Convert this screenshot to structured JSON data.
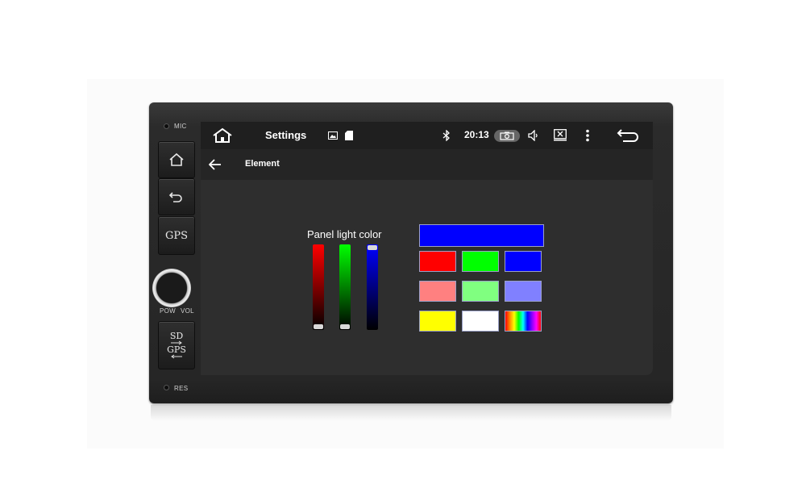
{
  "device": {
    "mic_label": "MIC",
    "gps_button_label": "GPS",
    "pow_label": "POW",
    "vol_label": "VOL",
    "sd_label": "SD",
    "sd_gps_label": "GPS",
    "res_label": "RES"
  },
  "statusbar": {
    "title": "Settings",
    "time": "20:13",
    "icons": [
      "home-icon",
      "image-icon",
      "sd-card-icon",
      "bluetooth-icon",
      "camera-icon",
      "volume-icon",
      "close-window-icon",
      "more-vert-icon",
      "back-icon"
    ]
  },
  "appbar": {
    "title": "Element",
    "back_icon": "arrow-left-icon"
  },
  "panel": {
    "label": "Panel light color",
    "sliders": [
      {
        "name": "red",
        "color": "#ff0000",
        "value": 0
      },
      {
        "name": "green",
        "color": "#00ff00",
        "value": 0
      },
      {
        "name": "blue",
        "color": "#0000ff",
        "value": 1
      }
    ],
    "selected_color": "#0000ff",
    "swatches": [
      "#ff0000",
      "#00ff00",
      "#0000ff",
      "#ff8080",
      "#80ff80",
      "#8080ff",
      "#ffff00",
      "#ffffff",
      "rainbow"
    ]
  }
}
